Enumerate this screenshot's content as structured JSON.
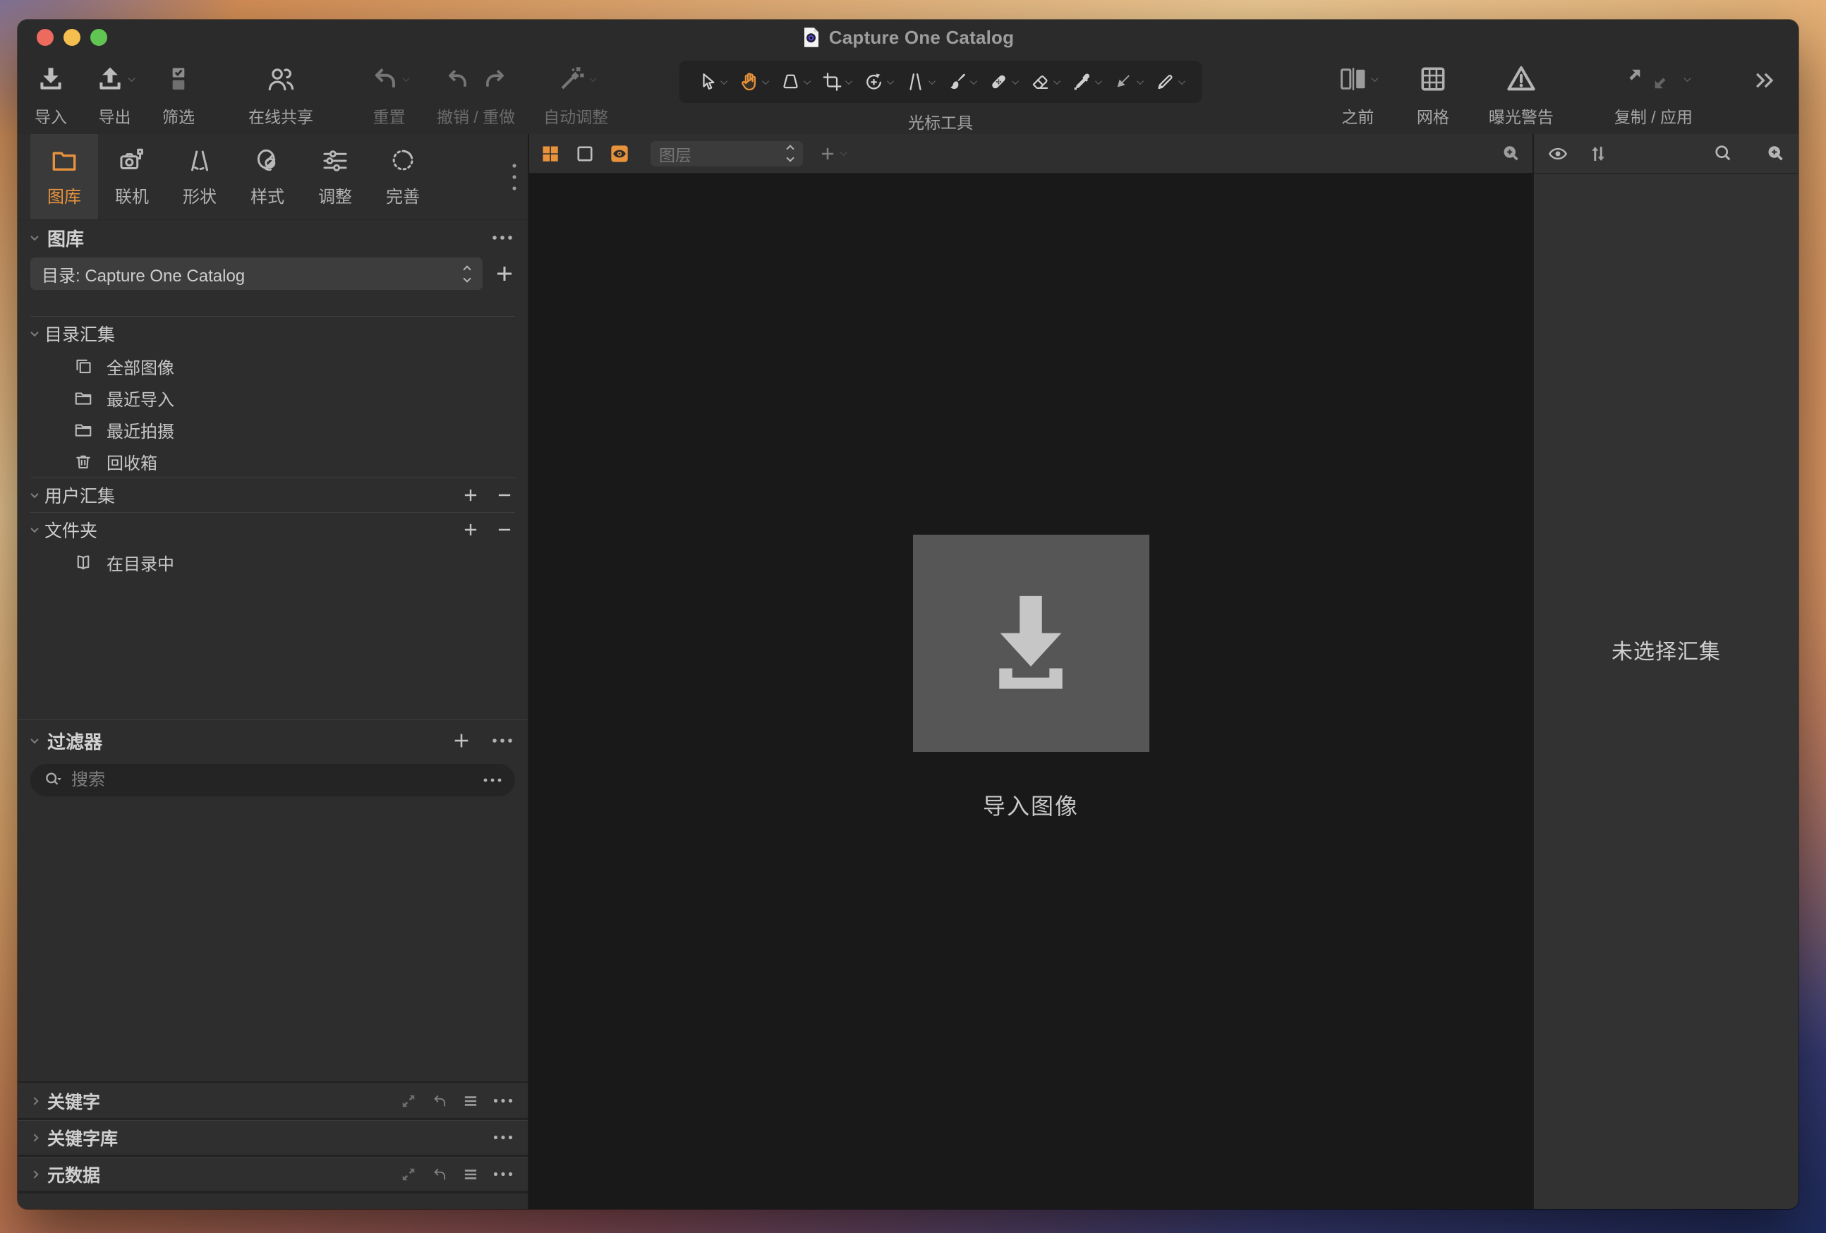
{
  "window": {
    "title": "Capture One Catalog"
  },
  "toolbar": {
    "import_label": "导入",
    "export_label": "导出",
    "cull_label": "筛选",
    "share_label": "在线共享",
    "reset_label": "重置",
    "undo_redo_label": "撤销 / 重做",
    "auto_adjust_label": "自动调整",
    "cursor_tools_label": "光标工具",
    "before_label": "之前",
    "grid_label": "网格",
    "exposure_warning_label": "曝光警告",
    "copy_apply_label": "复制 / 应用",
    "cursor_tools": [
      {
        "name": "pointer",
        "selected": false
      },
      {
        "name": "pan-hand",
        "selected": true
      },
      {
        "name": "loupe",
        "selected": false
      },
      {
        "name": "crop",
        "selected": false
      },
      {
        "name": "rotate",
        "selected": false
      },
      {
        "name": "keystone",
        "selected": false
      },
      {
        "name": "brush",
        "selected": false
      },
      {
        "name": "heal",
        "selected": false
      },
      {
        "name": "erase",
        "selected": false
      },
      {
        "name": "pick",
        "selected": false
      },
      {
        "name": "apply-arrow",
        "selected": false
      },
      {
        "name": "draw",
        "selected": false
      }
    ]
  },
  "sidebar": {
    "tabs": [
      {
        "label": "图库",
        "active": true
      },
      {
        "label": "联机",
        "active": false
      },
      {
        "label": "形状",
        "active": false
      },
      {
        "label": "样式",
        "active": false
      },
      {
        "label": "调整",
        "active": false
      },
      {
        "label": "完善",
        "active": false
      }
    ],
    "library": {
      "title": "图库",
      "catalog_selector": "目录: Capture One Catalog",
      "catalog_collections": {
        "label": "目录汇集",
        "items": [
          {
            "label": "全部图像",
            "icon": "all-images-icon"
          },
          {
            "label": "最近导入",
            "icon": "folder-icon"
          },
          {
            "label": "最近拍摄",
            "icon": "folder-icon"
          },
          {
            "label": "回收箱",
            "icon": "trash-icon"
          }
        ]
      },
      "user_collections": {
        "label": "用户汇集"
      },
      "folders": {
        "label": "文件夹",
        "items": [
          {
            "label": "在目录中",
            "icon": "book-icon"
          }
        ]
      }
    },
    "filters": {
      "title": "过滤器",
      "search_placeholder": "搜索"
    },
    "bottom_panels": [
      {
        "title": "关键字"
      },
      {
        "title": "关键字库"
      },
      {
        "title": "元数据"
      }
    ]
  },
  "viewer": {
    "layers_label": "图层",
    "import_caption": "导入图像"
  },
  "right_panel": {
    "empty_text": "未选择汇集"
  },
  "colors": {
    "accent": "#e8933c",
    "window_bg": "#2b2b2b",
    "canvas_bg": "#191919"
  }
}
